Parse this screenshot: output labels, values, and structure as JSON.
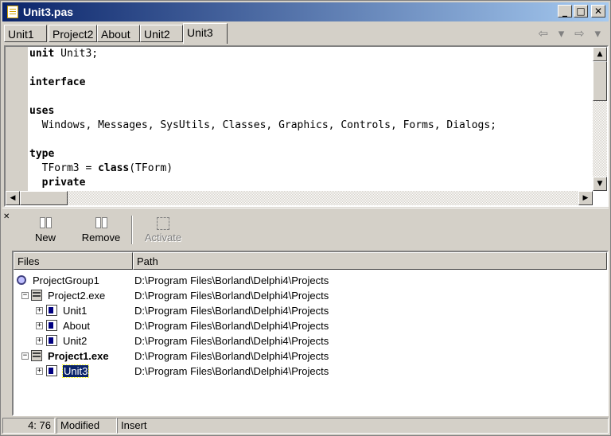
{
  "window": {
    "title": "Unit3.pas",
    "minimize_glyph": "_",
    "maximize_glyph": "□",
    "close_glyph": "✕"
  },
  "tabs": [
    {
      "label": "Unit1"
    },
    {
      "label": "Project2"
    },
    {
      "label": "About"
    },
    {
      "label": "Unit2"
    },
    {
      "label": "Unit3",
      "active": true
    }
  ],
  "nav": {
    "back": "⇦ ▾",
    "forward": "⇨ ▾"
  },
  "editor": {
    "lines": [
      {
        "kw": "unit",
        "rest": " Unit3;"
      },
      {
        "kw": "",
        "rest": ""
      },
      {
        "kw": "interface",
        "rest": ""
      },
      {
        "kw": "",
        "rest": ""
      },
      {
        "kw": "uses",
        "rest": ""
      },
      {
        "kw": "",
        "rest": "  Windows, Messages, SysUtils, Classes, Graphics, Controls, Forms, Dialogs;"
      },
      {
        "kw": "",
        "rest": ""
      },
      {
        "kw": "type",
        "rest": ""
      },
      {
        "pre": "  TForm3 = ",
        "kw": "class",
        "rest": "(TForm)"
      },
      {
        "pre": "  ",
        "kw": "private",
        "rest": ""
      }
    ]
  },
  "scroll": {
    "up": "▲",
    "down": "▼",
    "left": "◀",
    "right": "▶"
  },
  "project_manager": {
    "close_glyph": "✕",
    "toolbar": {
      "new_label": "New",
      "remove_label": "Remove",
      "activate_label": "Activate"
    },
    "columns": {
      "files": "Files",
      "path": "Path"
    },
    "rows": [
      {
        "name": "ProjectGroup1",
        "path": "D:\\Program Files\\Borland\\Delphi4\\Projects"
      },
      {
        "name": "Project2.exe",
        "path": "D:\\Program Files\\Borland\\Delphi4\\Projects",
        "expander": "−"
      },
      {
        "name": "Unit1",
        "path": "D:\\Program Files\\Borland\\Delphi4\\Projects",
        "expander": "+"
      },
      {
        "name": "About",
        "path": "D:\\Program Files\\Borland\\Delphi4\\Projects",
        "expander": "+"
      },
      {
        "name": "Unit2",
        "path": "D:\\Program Files\\Borland\\Delphi4\\Projects",
        "expander": "+"
      },
      {
        "name": "Project1.exe",
        "path": "D:\\Program Files\\Borland\\Delphi4\\Projects",
        "expander": "−"
      },
      {
        "name": "Unit3",
        "path": "D:\\Program Files\\Borland\\Delphi4\\Projects",
        "expander": "+"
      }
    ]
  },
  "status": {
    "position": "4: 76",
    "modified": "Modified",
    "mode": "Insert"
  },
  "colors": {
    "face": "#d4d0c8",
    "title_start": "#0a246a",
    "title_end": "#a6caf0",
    "selection": "#0a246a"
  }
}
